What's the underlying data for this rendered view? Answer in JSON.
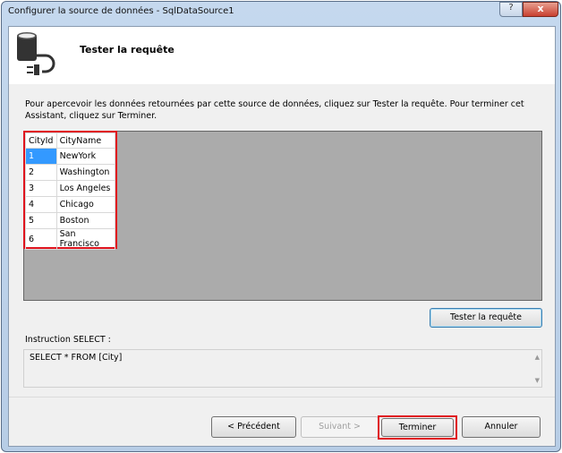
{
  "window": {
    "title": "Configurer la source de données - SqlDataSource1",
    "help_icon": "?",
    "close_icon": "x"
  },
  "header": {
    "title": "Tester la requête",
    "icon": "database-plug-icon"
  },
  "description": "Pour apercevoir les données retournées par cette source de données, cliquez sur Tester la requête. Pour terminer cet Assistant, cliquez sur Terminer.",
  "results": {
    "columns": [
      "CityId",
      "CityName"
    ],
    "rows": [
      [
        "1",
        "NewYork"
      ],
      [
        "2",
        "Washington"
      ],
      [
        "3",
        "Los Angeles"
      ],
      [
        "4",
        "Chicago"
      ],
      [
        "5",
        "Boston"
      ],
      [
        "6",
        "San Francisco"
      ]
    ]
  },
  "test_button": "Tester la requête",
  "select_label": "Instruction SELECT :",
  "select_statement": "SELECT * FROM [City]",
  "buttons": {
    "previous": "< Précédent",
    "next": "Suivant >",
    "finish": "Terminer",
    "cancel": "Annuler"
  },
  "colors": {
    "highlight": "#e0141e",
    "selection": "#3399ff"
  }
}
